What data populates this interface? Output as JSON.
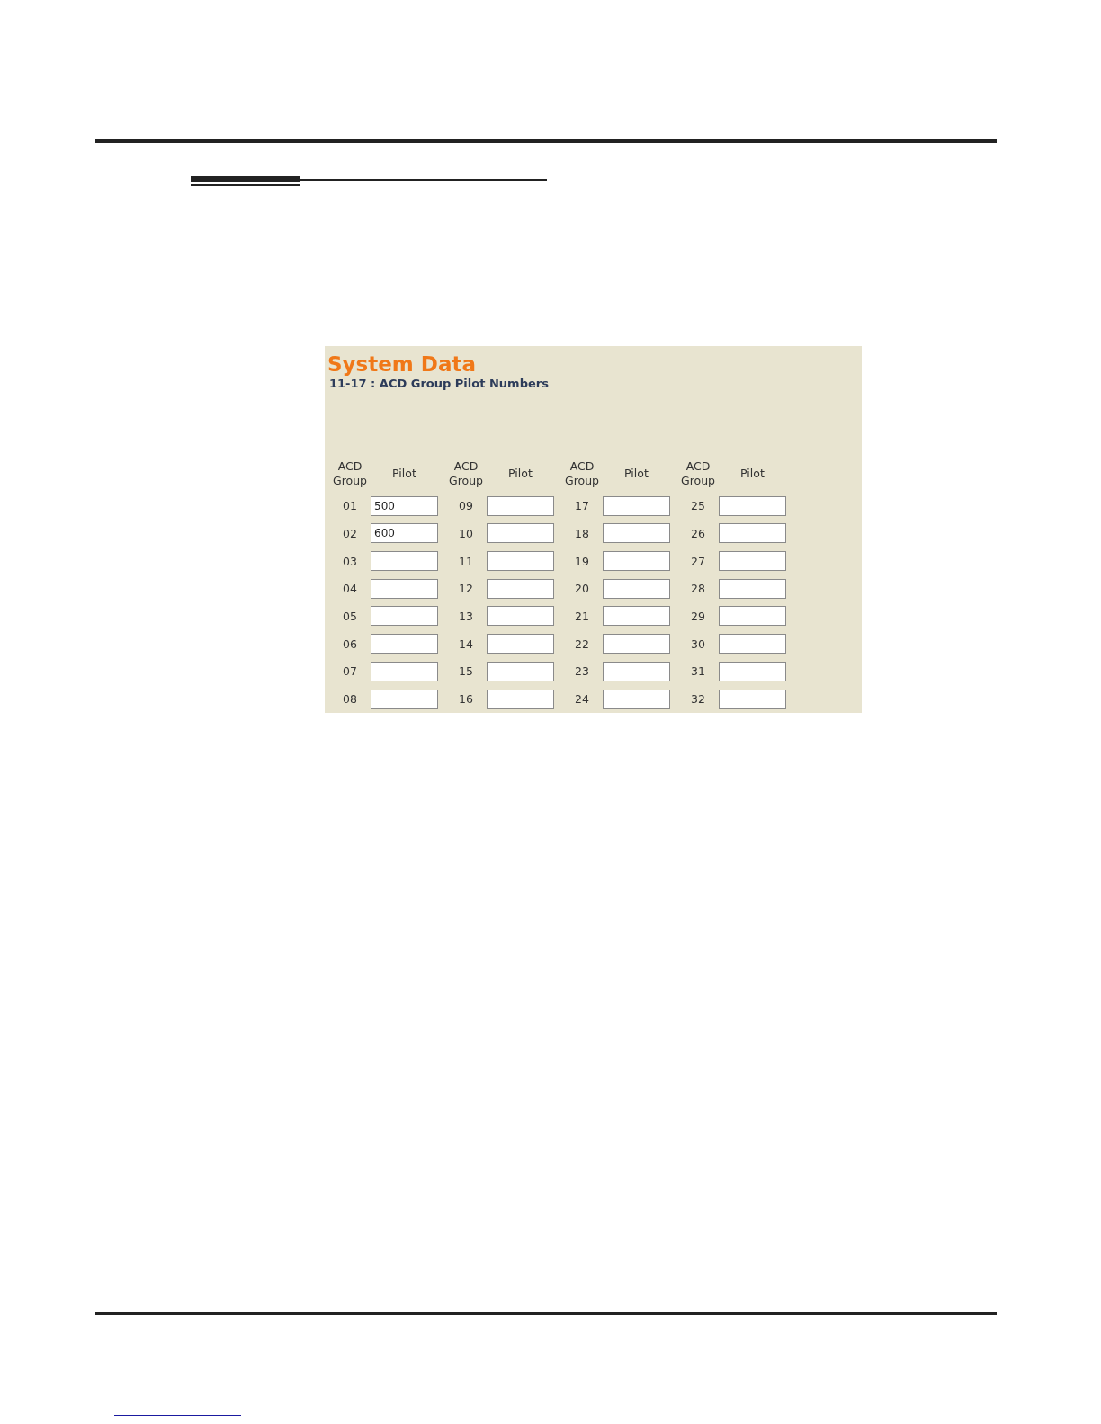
{
  "panel": {
    "title": "System Data",
    "subtitle": "11-17 : ACD Group Pilot Numbers",
    "columns": [
      {
        "group_header": "ACD Group",
        "pilot_header": "Pilot",
        "entries": [
          {
            "group": "01",
            "pilot": "500"
          },
          {
            "group": "02",
            "pilot": "600"
          },
          {
            "group": "03"
          },
          {
            "group": "04"
          },
          {
            "group": "05"
          },
          {
            "group": "06"
          },
          {
            "group": "07"
          },
          {
            "group": "08"
          }
        ]
      },
      {
        "group_header": "ACD Group",
        "pilot_header": "Pilot",
        "entries": [
          {
            "group": "09"
          },
          {
            "group": "10"
          },
          {
            "group": "11"
          },
          {
            "group": "12"
          },
          {
            "group": "13"
          },
          {
            "group": "14"
          },
          {
            "group": "15"
          },
          {
            "group": "16"
          }
        ]
      },
      {
        "group_header": "ACD Group",
        "pilot_header": "Pilot",
        "entries": [
          {
            "group": "17"
          },
          {
            "group": "18"
          },
          {
            "group": "19"
          },
          {
            "group": "20"
          },
          {
            "group": "21"
          },
          {
            "group": "22"
          },
          {
            "group": "23"
          },
          {
            "group": "24"
          }
        ]
      },
      {
        "group_header": "ACD Group",
        "pilot_header": "Pilot",
        "entries": [
          {
            "group": "25"
          },
          {
            "group": "26"
          },
          {
            "group": "27"
          },
          {
            "group": "28"
          },
          {
            "group": "29"
          },
          {
            "group": "30"
          },
          {
            "group": "31"
          },
          {
            "group": "32"
          }
        ]
      }
    ]
  }
}
